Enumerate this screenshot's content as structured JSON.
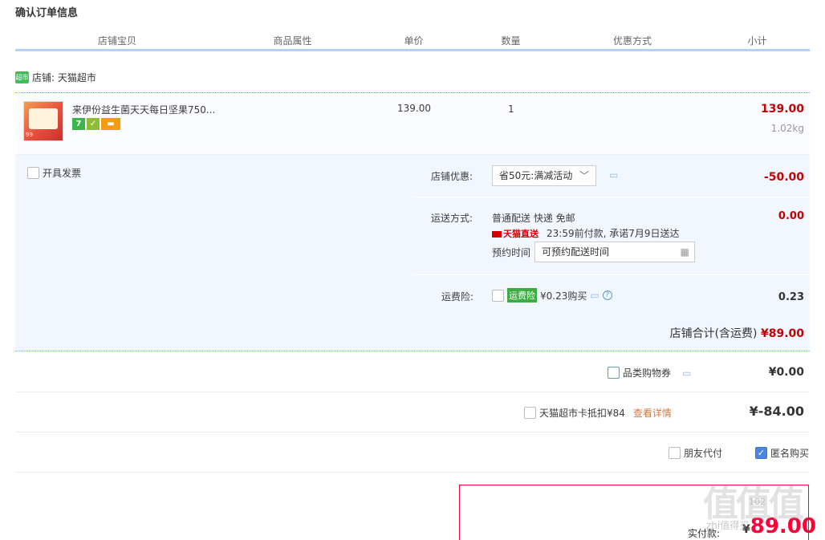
{
  "page_title": "确认订单信息",
  "table_headers": [
    "店铺宝贝",
    "商品属性",
    "单价",
    "数量",
    "优惠方式",
    "小计"
  ],
  "shop": {
    "badge": "超市",
    "label": "店铺: 天猫超市"
  },
  "item": {
    "name": "来伊份益生菌天天每日坚果750...",
    "unit_price": "139.00",
    "quantity": "1",
    "subtotal": "139.00",
    "weight": "1.02kg",
    "icons": [
      "seven-day-return-icon",
      "quality-cert-icon",
      "card-payment-icon"
    ],
    "icon_text_seven": "7",
    "thumb_tag": "99"
  },
  "invoice": {
    "label": "开具发票"
  },
  "shop_discount": {
    "label": "店铺优惠:",
    "selected": "省50元:满减活动",
    "amount": "-50.00"
  },
  "shipping": {
    "label": "运送方式:",
    "method": "普通配送 快递 免邮",
    "tmall_tag": "天猫直送",
    "promise": "23:59前付款, 承诺7月9日送达",
    "schedule_label": "预约时间",
    "schedule_placeholder": "可预约配送时间",
    "amount": "0.00"
  },
  "insurance": {
    "label": "运费险:",
    "tag": "运费险",
    "price_text": "¥0.23购买",
    "amount": "0.23"
  },
  "shop_total": {
    "label": "店铺合计(含运费)",
    "amount": "¥89.00"
  },
  "category_coupon": {
    "label": "品类购物券",
    "amount": "¥0.00"
  },
  "tmall_card": {
    "label": "天猫超市卡抵扣¥84",
    "link": "查看详情",
    "amount": "¥-84.00"
  },
  "friend_pay": {
    "label": "朋友代付"
  },
  "anonymous": {
    "label": "匿名购买",
    "checked": true
  },
  "payment": {
    "label": "实付款:",
    "currency": "¥",
    "amount": "89.00",
    "ghost_text": "102"
  },
  "watermark": {
    "main": "值值值",
    "sub": "zhi值得买"
  },
  "colors": {
    "price_red": "#c40000",
    "accent_blue": "#b2d1ff",
    "pay_red": "#ff0036"
  }
}
